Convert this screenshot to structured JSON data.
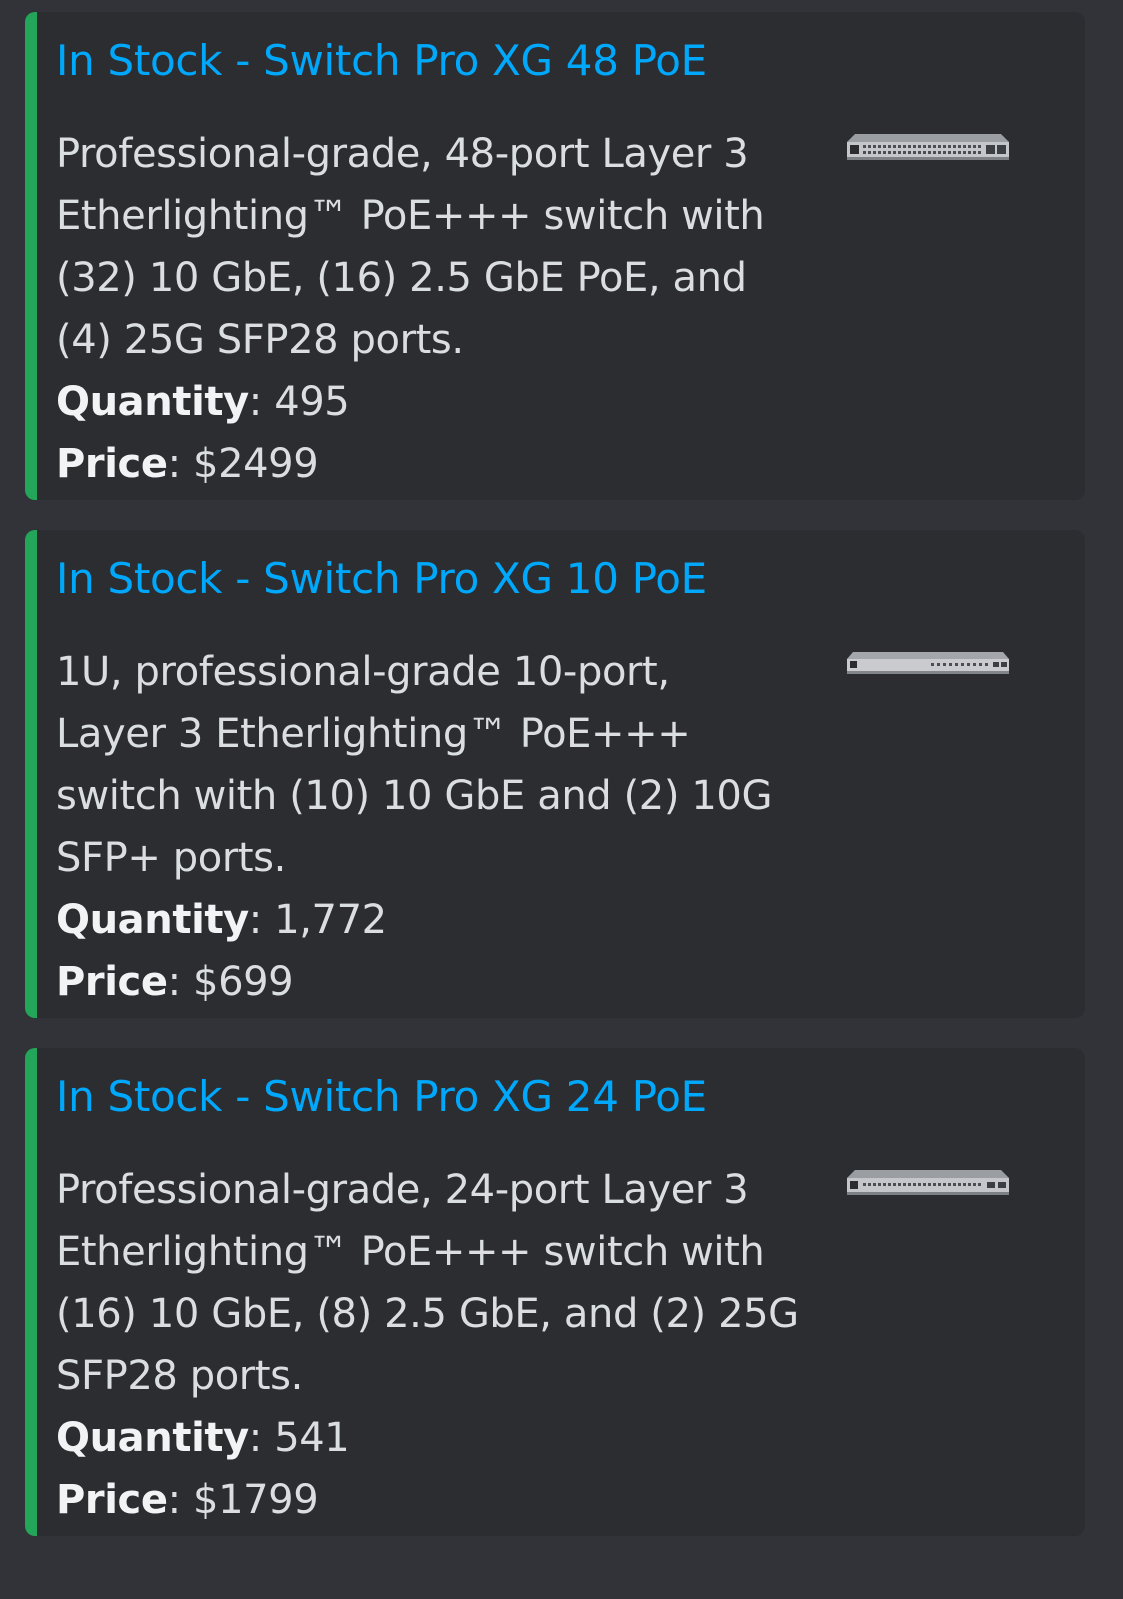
{
  "colors": {
    "background": "#313338",
    "embed_background": "#2b2d31",
    "accent_bar": "#23a55a",
    "title_link": "#00a8fc",
    "text": "#dbdee1"
  },
  "embeds": [
    {
      "title": "In Stock - Switch Pro XG 48 PoE",
      "description_lines": [
        "Professional-grade, 48-port Layer 3",
        "Etherlighting™ PoE+++ switch with",
        "(32) 10 GbE, (16) 2.5 GbE PoE, and",
        "(4) 25G SFP28 ports."
      ],
      "quantity_label": "Quantity",
      "quantity_value": "495",
      "price_label": "Price",
      "price_value": "$2499",
      "thumbnail_icon": "network-switch-48-port-icon"
    },
    {
      "title": "In Stock - Switch Pro XG 10 PoE",
      "description_lines": [
        "1U, professional-grade 10-port,",
        "Layer 3 Etherlighting™ PoE+++",
        "switch with (10) 10 GbE and (2) 10G",
        "SFP+ ports."
      ],
      "quantity_label": "Quantity",
      "quantity_value": "1,772",
      "price_label": "Price",
      "price_value": "$699",
      "thumbnail_icon": "network-switch-10-port-icon"
    },
    {
      "title": "In Stock - Switch Pro XG 24 PoE",
      "description_lines": [
        "Professional-grade, 24-port Layer 3",
        "Etherlighting™ PoE+++ switch with",
        "(16) 10 GbE, (8) 2.5 GbE, and (2) 25G",
        "SFP28 ports."
      ],
      "quantity_label": "Quantity",
      "quantity_value": "541",
      "price_label": "Price",
      "price_value": "$1799",
      "thumbnail_icon": "network-switch-24-port-icon"
    }
  ]
}
